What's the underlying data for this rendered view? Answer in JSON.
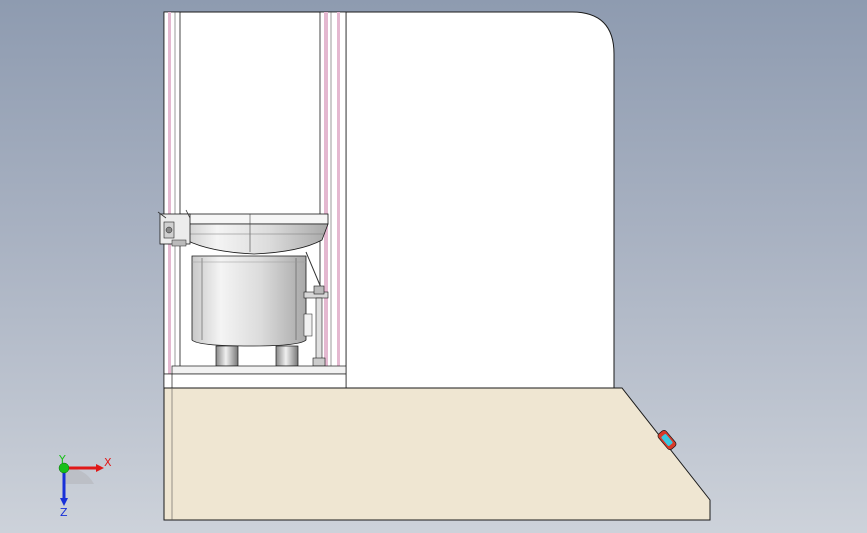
{
  "viewport": {
    "background_top": "#8e9bb0",
    "background_bottom": "#cdd2da"
  },
  "model": {
    "parts": [
      "machine-frame",
      "left-column",
      "right-column",
      "feeder-bowl",
      "bowl-rim",
      "bowl-feet",
      "side-bracket",
      "support-rod",
      "base-cabinet",
      "indicator-light"
    ],
    "colors": {
      "frame": "#ffffff",
      "outline": "#1a1a1a",
      "column_accent": "#e4b8d0",
      "base": "#efe6d2",
      "bowl": "#e6e6e6",
      "indicator": "#d83a2a",
      "indicator_lens": "#38c8e0"
    }
  },
  "triad": {
    "x_label": "X",
    "y_label": "Y",
    "z_label": "Z",
    "x_color": "#e01818",
    "y_color": "#18c018",
    "z_color": "#1830d8"
  }
}
